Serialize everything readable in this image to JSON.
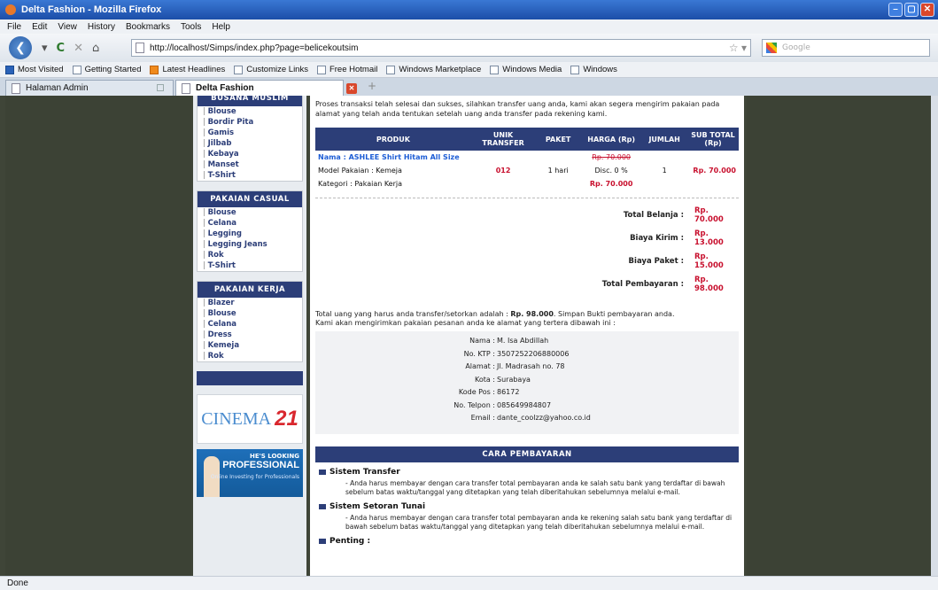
{
  "window": {
    "title": "Delta Fashion - Mozilla Firefox"
  },
  "menu": [
    "File",
    "Edit",
    "View",
    "History",
    "Bookmarks",
    "Tools",
    "Help"
  ],
  "nav": {
    "url": "http://localhost/Simps/index.php?page=belicekoutsim",
    "search_placeholder": "Google"
  },
  "bookmarks": [
    "Most Visited",
    "Getting Started",
    "Latest Headlines",
    "Customize Links",
    "Free Hotmail",
    "Windows Marketplace",
    "Windows Media",
    "Windows"
  ],
  "tabs": [
    {
      "label": "Halaman Admin"
    },
    {
      "label": "Delta Fashion"
    }
  ],
  "sidebar": {
    "groups": [
      {
        "title": "BUSANA MUSLIM",
        "items": [
          "Blouse",
          "Bordir Pita",
          "Gamis",
          "Jilbab",
          "Kebaya",
          "Manset",
          "T-Shirt"
        ]
      },
      {
        "title": "PAKAIAN CASUAL",
        "items": [
          "Blouse",
          "Celana",
          "Legging",
          "Legging Jeans",
          "Rok",
          "T-Shirt"
        ]
      },
      {
        "title": "PAKAIAN KERJA",
        "items": [
          "Blazer",
          "Blouse",
          "Celana",
          "Dress",
          "Kemeja",
          "Rok"
        ]
      }
    ],
    "ad1": {
      "text": "CINEMA",
      "num": "21"
    },
    "ad2": {
      "line1": "HE'S LOOKING",
      "line2": "PROFESSIONAL",
      "line3": "Online Investing for Professionals"
    }
  },
  "main": {
    "intro": "Proses transaksi telah selesai dan sukses, silahkan transfer uang anda, kami akan segera mengirim pakaian pada alamat yang telah anda tentukan setelah uang anda transfer pada rekening kami.",
    "headers": [
      "PRODUK",
      "UNIK TRANSFER",
      "PAKET",
      "HARGA (Rp)",
      "JUMLAH",
      "SUB TOTAL (Rp)"
    ],
    "order": {
      "name": "Nama : ASHLEE Shirt Hitam All Size",
      "model": "Model Pakaian : Kemeja",
      "kategori": "Kategori : Pakaian Kerja",
      "unik": "012",
      "paket": "1 hari",
      "harga_old": "Rp. 70.000",
      "disc": "Disc. 0 %",
      "harga_new": "Rp. 70.000",
      "jumlah": "1",
      "subtotal": "Rp. 70.000"
    },
    "totals": [
      {
        "label": "Total Belanja :",
        "value": "Rp. 70.000"
      },
      {
        "label": "Biaya Kirim :",
        "value": "Rp. 13.000"
      },
      {
        "label": "Biaya Paket :",
        "value": "Rp. 15.000"
      },
      {
        "label": "Total Pembayaran :",
        "value": "Rp. 98.000"
      }
    ],
    "note1_pre": "Total uang yang harus anda transfer/setorkan adalah : ",
    "note1_amount": "Rp. 98.000",
    "note1_post": ". Simpan Bukti pembayaran anda.",
    "note2": "Kami akan mengirimkan pakaian pesanan anda ke alamat yang tertera dibawah ini :",
    "address": [
      {
        "k": "Nama :",
        "v": "M. Isa Abdillah"
      },
      {
        "k": "No. KTP :",
        "v": "3507252206880006"
      },
      {
        "k": "Alamat :",
        "v": "Jl. Madrasah no. 78"
      },
      {
        "k": "Kota :",
        "v": "Surabaya"
      },
      {
        "k": "Kode Pos :",
        "v": "86172"
      },
      {
        "k": "No. Telpon :",
        "v": "085649984807"
      },
      {
        "k": "Email :",
        "v": "dante_coolzz@yahoo.co.id"
      }
    ],
    "cara_title": "CARA PEMBAYARAN",
    "sections": [
      {
        "title": "Sistem Transfer",
        "body": "- Anda harus membayar dengan cara transfer total pembayaran anda ke salah satu bank yang terdaftar di bawah sebelum batas waktu/tanggal yang ditetapkan yang telah diberitahukan sebelumnya melalui e-mail."
      },
      {
        "title": "Sistem Setoran Tunai",
        "body": "- Anda harus membayar dengan cara transfer total pembayaran anda ke rekening salah satu bank yang terdaftar di bawah sebelum batas waktu/tanggal yang ditetapkan yang telah diberitahukan sebelumnya melalui e-mail."
      },
      {
        "title": "Penting :",
        "body": ""
      }
    ]
  },
  "status": "Done"
}
